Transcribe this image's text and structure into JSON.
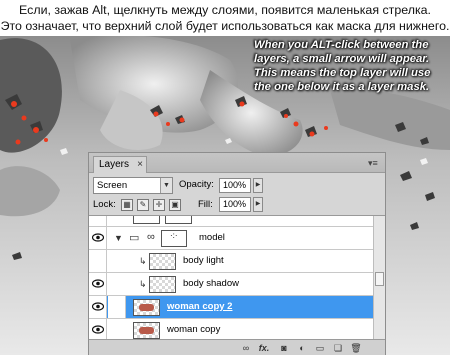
{
  "caption_ru": {
    "line1": "Если, зажав Alt, щелкнуть между слоями, появится маленькая стрелка.",
    "line2": "Это означает, что верхний слой будет использоваться как маска для нижнего."
  },
  "caption_en": {
    "line1": "When you ALT-click between the",
    "line2": "layers, a small arrow will appear.",
    "line3": "This means the top layer will use",
    "line4": "the one below it as a layer mask."
  },
  "panel": {
    "tab_label": "Layers",
    "tab_close": "×",
    "menu_icon": "panel-menu-icon",
    "blend_mode": "Screen",
    "opacity_label": "Opacity:",
    "opacity_value": "100%",
    "lock_label": "Lock:",
    "fill_label": "Fill:",
    "fill_value": "100%"
  },
  "layers": [
    {
      "name": "model",
      "type": "group",
      "expanded": true
    },
    {
      "name": "body light",
      "clipped": true
    },
    {
      "name": "body shadow",
      "clipped": true
    },
    {
      "name": "woman copy 2",
      "selected": true
    },
    {
      "name": "woman copy"
    }
  ],
  "footer_icons": [
    "link-icon",
    "fx-icon",
    "mask-icon",
    "adjustment-icon",
    "group-icon",
    "new-layer-icon",
    "trash-icon"
  ],
  "colors": {
    "selection": "#3f97ef",
    "panel_bg": "#d6d6d6"
  }
}
